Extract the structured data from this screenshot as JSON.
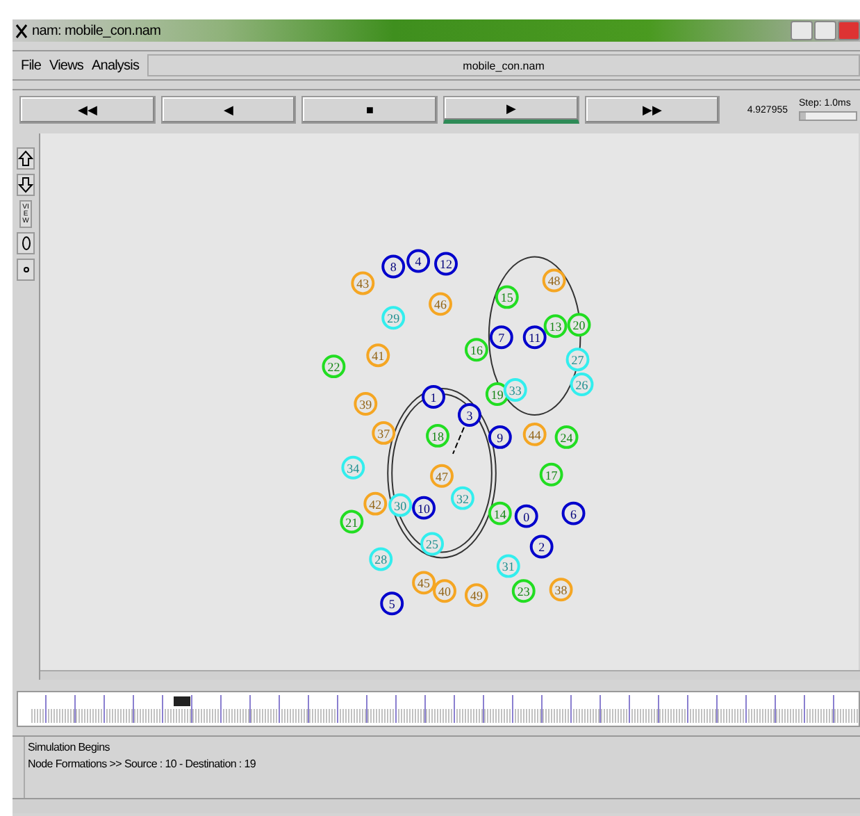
{
  "window": {
    "title": "nam: mobile_con.nam"
  },
  "menu": [
    {
      "label": "File"
    },
    {
      "label": "Views"
    },
    {
      "label": "Analysis"
    }
  ],
  "file_name": "mobile_con.nam",
  "controls": [
    {
      "label": "◀◀",
      "selected": false
    },
    {
      "label": "◀",
      "selected": false
    },
    {
      "label": "■",
      "selected": false
    },
    {
      "label": "▶",
      "selected": true
    },
    {
      "label": "▶▶",
      "selected": false
    }
  ],
  "time": "4.927955",
  "step": {
    "label": "Step: 1.0ms",
    "level": 0.1
  },
  "side_tools": [
    {
      "kind": "zoom-in"
    },
    {
      "kind": "zoom-out"
    },
    {
      "kind": "text",
      "label": "VIEW"
    },
    {
      "kind": "oval"
    },
    {
      "kind": "dot"
    }
  ],
  "nodes": [
    {
      "label": "8",
      "color": "#0000cc"
    },
    {
      "label": "4",
      "color": "#0000cc"
    },
    {
      "label": "12",
      "color": "#0000cc"
    },
    {
      "label": "43",
      "color": "#f5a623"
    },
    {
      "label": "46",
      "color": "#f5a623"
    },
    {
      "label": "29",
      "color": "#33eeee"
    },
    {
      "label": "41",
      "color": "#f5a623"
    },
    {
      "label": "22",
      "color": "#22dd22"
    },
    {
      "label": "39",
      "color": "#f5a623"
    },
    {
      "label": "16",
      "color": "#22dd22"
    },
    {
      "label": "7",
      "color": "#0000cc"
    },
    {
      "label": "11",
      "color": "#0000cc"
    },
    {
      "label": "15",
      "color": "#22dd22"
    },
    {
      "label": "48",
      "color": "#f5a623"
    },
    {
      "label": "13",
      "color": "#22dd22"
    },
    {
      "label": "20",
      "color": "#22dd22"
    },
    {
      "label": "27",
      "color": "#33eeee"
    },
    {
      "label": "26",
      "color": "#33eeee"
    },
    {
      "label": "19",
      "color": "#22dd22"
    },
    {
      "label": "33",
      "color": "#33eeee"
    },
    {
      "label": "1",
      "color": "#0000cc"
    },
    {
      "label": "3",
      "color": "#0000cc"
    },
    {
      "label": "37",
      "color": "#f5a623"
    },
    {
      "label": "18",
      "color": "#22dd22"
    },
    {
      "label": "9",
      "color": "#0000cc"
    },
    {
      "label": "44",
      "color": "#f5a623"
    },
    {
      "label": "24",
      "color": "#22dd22"
    },
    {
      "label": "34",
      "color": "#33eeee"
    },
    {
      "label": "47",
      "color": "#f5a623"
    },
    {
      "label": "17",
      "color": "#22dd22"
    },
    {
      "label": "42",
      "color": "#f5a623"
    },
    {
      "label": "30",
      "color": "#33eeee"
    },
    {
      "label": "10",
      "color": "#0000cc"
    },
    {
      "label": "32",
      "color": "#33eeee"
    },
    {
      "label": "21",
      "color": "#22dd22"
    },
    {
      "label": "14",
      "color": "#22dd22"
    },
    {
      "label": "0",
      "color": "#0000cc"
    },
    {
      "label": "6",
      "color": "#0000cc"
    },
    {
      "label": "2",
      "color": "#0000cc"
    },
    {
      "label": "25",
      "color": "#33eeee"
    },
    {
      "label": "28",
      "color": "#33eeee"
    },
    {
      "label": "31",
      "color": "#33eeee"
    },
    {
      "label": "45",
      "color": "#f5a623"
    },
    {
      "label": "40",
      "color": "#f5a623"
    },
    {
      "label": "49",
      "color": "#f5a623"
    },
    {
      "label": "23",
      "color": "#22dd22"
    },
    {
      "label": "38",
      "color": "#f5a623"
    },
    {
      "label": "5",
      "color": "#0000cc"
    }
  ],
  "log": [
    "Simulation Begins",
    "Node Formations >> Source : 10 - Destination : 19"
  ]
}
